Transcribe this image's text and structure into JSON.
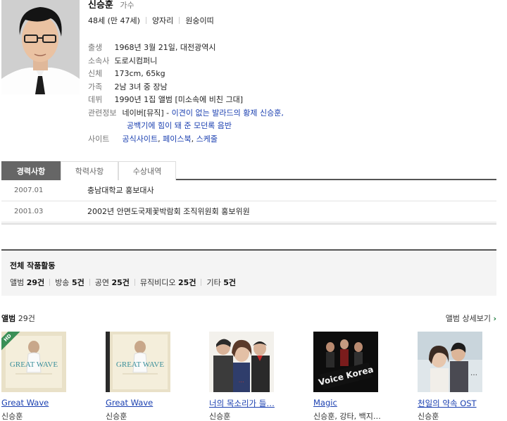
{
  "profile": {
    "name": "신승훈",
    "job": "가수",
    "meta": [
      "48세 (만 47세)",
      "양자리",
      "원숭이띠"
    ],
    "details": [
      {
        "label": "출생",
        "value": "1968년 3월 21일, 대전광역시"
      },
      {
        "label": "소속사",
        "value": "도로시컴퍼니"
      },
      {
        "label": "신체",
        "value": "173cm, 65kg"
      },
      {
        "label": "가족",
        "value": "2남 3녀 중 장남"
      },
      {
        "label": "데뷔",
        "value": "1990년 1집 앨범 [미소속에 비친 그대]"
      }
    ],
    "related": {
      "label": "관련정보",
      "prefix": "네이버[뮤직]",
      "line1": "이견이 없는 발라드의 황제 신승훈,",
      "line2": "공백기에 힘이 돼 준 모던록 음반"
    },
    "site": {
      "label": "사이트",
      "links": [
        "공식사이트",
        "페이스북",
        "스케줄"
      ]
    }
  },
  "tabs": [
    "경력사항",
    "학력사항",
    "수상내역"
  ],
  "career": [
    {
      "date": "2007.01",
      "desc": "충남대학교 홍보대사"
    },
    {
      "date": "2001.03",
      "desc": "2002년 안면도국제꽃박람회 조직위원회 홍보위원"
    }
  ],
  "works": {
    "title": "전체 작품활동",
    "items": [
      {
        "label": "앨범",
        "count": "29건"
      },
      {
        "label": "방송",
        "count": "5건"
      },
      {
        "label": "공연",
        "count": "25건"
      },
      {
        "label": "뮤직비디오",
        "count": "25건"
      },
      {
        "label": "기타",
        "count": "5건"
      }
    ]
  },
  "albums": {
    "label": "앨범",
    "count": "29건",
    "more": "앨범 상세보기",
    "items": [
      {
        "title": "Great Wave",
        "artist": "신승훈",
        "cover_text": "GREAT WAVE",
        "badge": "HD"
      },
      {
        "title": "Great Wave",
        "artist": "신승훈",
        "cover_text": "GREAT WAVE"
      },
      {
        "title": "너의 목소리가 들…",
        "artist": "신승훈"
      },
      {
        "title": "Magic",
        "artist": "신승훈, 강타, 백지…",
        "cover_text": "Voice Korea"
      },
      {
        "title": "천일의 약속 OST",
        "artist": "신승훈"
      }
    ]
  }
}
